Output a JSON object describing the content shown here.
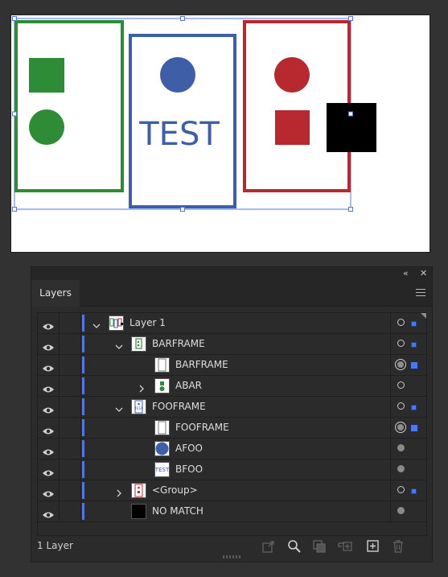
{
  "colors": {
    "green": "#2e8b36",
    "blue": "#3e5fa8",
    "red": "#b7292f",
    "black": "#000000",
    "selection_blue": "#4a78f5"
  },
  "artboard": {
    "art_text": "TEST"
  },
  "panel": {
    "collapse_icon": "double-chevron-left-icon",
    "close_icon": "close-icon",
    "tab_label": "Layers",
    "menu_icon": "hamburger-menu-icon"
  },
  "layers": [
    {
      "name": "Layer 1",
      "depth": 0,
      "expander": "open",
      "thumb": "layer1",
      "target": "ring",
      "selected_square": "small"
    },
    {
      "name": "BARFRAME",
      "depth": 1,
      "expander": "open",
      "thumb": "barframe-group",
      "target": "ring",
      "selected_square": "small"
    },
    {
      "name": "BARFRAME",
      "depth": 2,
      "expander": "none",
      "thumb": "frame",
      "target": "selected",
      "selected_square": "big"
    },
    {
      "name": "ABAR",
      "depth": 2,
      "expander": "closed",
      "thumb": "abar",
      "target": "ring",
      "selected_square": "none"
    },
    {
      "name": "FOOFRAME",
      "depth": 1,
      "expander": "open",
      "thumb": "fooframe-group",
      "target": "ring",
      "selected_square": "small"
    },
    {
      "name": "FOOFRAME",
      "depth": 2,
      "expander": "none",
      "thumb": "frame",
      "target": "selected",
      "selected_square": "big"
    },
    {
      "name": "AFOO",
      "depth": 2,
      "expander": "none",
      "thumb": "afoo",
      "target": "filled",
      "selected_square": "none"
    },
    {
      "name": "BFOO",
      "depth": 2,
      "expander": "none",
      "thumb": "bfoo",
      "target": "filled",
      "selected_square": "none"
    },
    {
      "name": "<Group>",
      "depth": 1,
      "expander": "closed",
      "thumb": "group-red",
      "target": "ring",
      "selected_square": "small"
    },
    {
      "name": "NO MATCH",
      "depth": 1,
      "expander": "none",
      "thumb": "black",
      "target": "filled",
      "selected_square": "none"
    }
  ],
  "footer": {
    "layer_count_label": "1 Layer",
    "buttons": [
      "export-icon",
      "locate-object-icon",
      "make-clipping-mask-icon",
      "create-sublayer-icon",
      "create-new-layer-icon",
      "delete-layer-icon"
    ]
  }
}
